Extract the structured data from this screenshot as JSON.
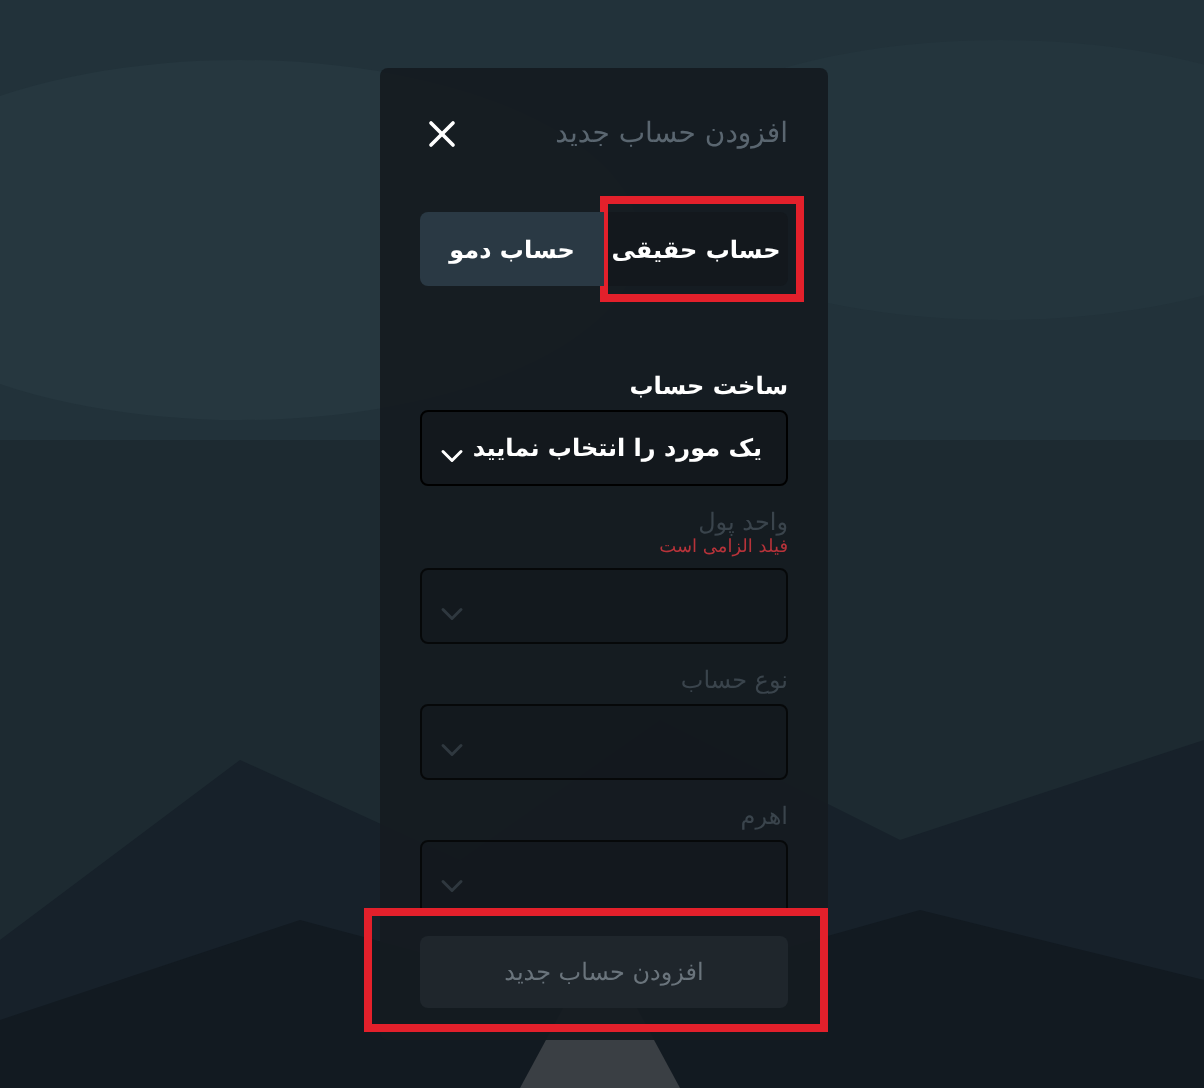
{
  "dialog": {
    "title": "افزودن حساب جدید"
  },
  "tabs": [
    {
      "label": "حساب حقیقی",
      "selected": true,
      "highlighted": true
    },
    {
      "label": "حساب دمو",
      "selected": false,
      "highlighted": false
    }
  ],
  "fields": [
    {
      "label": "ساخت حساب",
      "value": "یک مورد را انتخاب نمایید",
      "disabled": false
    },
    {
      "label": "واحد پول",
      "error": "فیلد الزامی است",
      "disabled": true
    },
    {
      "label": "نوع حساب",
      "disabled": true
    },
    {
      "label": "اهرم",
      "disabled": true
    }
  ],
  "submit_button": {
    "label": "افزودن حساب جدید",
    "disabled": true,
    "highlighted": true
  }
}
